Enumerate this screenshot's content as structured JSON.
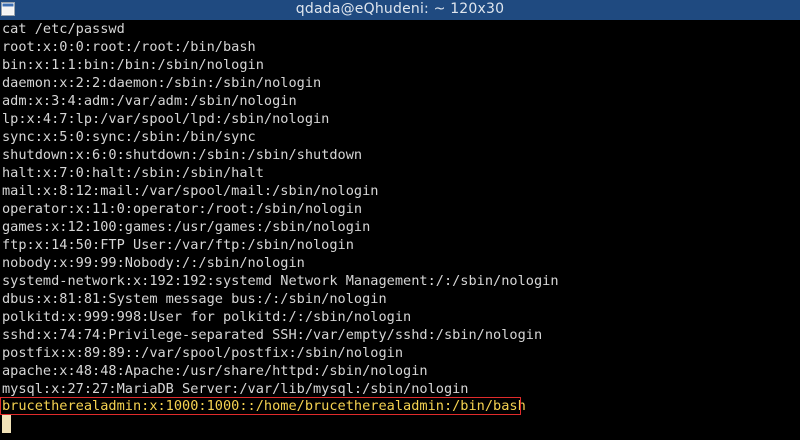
{
  "window": {
    "title": "qdada@eQhudeni: ~ 120x30",
    "icon": "terminal-icon"
  },
  "terminal": {
    "lines": [
      "cat /etc/passwd",
      "root:x:0:0:root:/root:/bin/bash",
      "bin:x:1:1:bin:/bin:/sbin/nologin",
      "daemon:x:2:2:daemon:/sbin:/sbin/nologin",
      "adm:x:3:4:adm:/var/adm:/sbin/nologin",
      "lp:x:4:7:lp:/var/spool/lpd:/sbin/nologin",
      "sync:x:5:0:sync:/sbin:/bin/sync",
      "shutdown:x:6:0:shutdown:/sbin:/sbin/shutdown",
      "halt:x:7:0:halt:/sbin:/sbin/halt",
      "mail:x:8:12:mail:/var/spool/mail:/sbin/nologin",
      "operator:x:11:0:operator:/root:/sbin/nologin",
      "games:x:12:100:games:/usr/games:/sbin/nologin",
      "ftp:x:14:50:FTP User:/var/ftp:/sbin/nologin",
      "nobody:x:99:99:Nobody:/:/sbin/nologin",
      "systemd-network:x:192:192:systemd Network Management:/:/sbin/nologin",
      "dbus:x:81:81:System message bus:/:/sbin/nologin",
      "polkitd:x:999:998:User for polkitd:/:/sbin/nologin",
      "sshd:x:74:74:Privilege-separated SSH:/var/empty/sshd:/sbin/nologin",
      "postfix:x:89:89::/var/spool/postfix:/sbin/nologin",
      "apache:x:48:48:Apache:/usr/share/httpd:/sbin/nologin",
      "mysql:x:27:27:MariaDB Server:/var/lib/mysql:/sbin/nologin",
      "brucetherealadmin:x:1000:1000::/home/brucetherealadmin:/bin/bash"
    ],
    "highlighted_index": 21
  },
  "colors": {
    "titlebar_bg": "#1f4a80",
    "terminal_bg": "#000000",
    "text": "#d6d6d6",
    "highlight_text": "#f5d251",
    "highlight_border": "#e02b2b",
    "cursor": "#f1e2b8"
  }
}
